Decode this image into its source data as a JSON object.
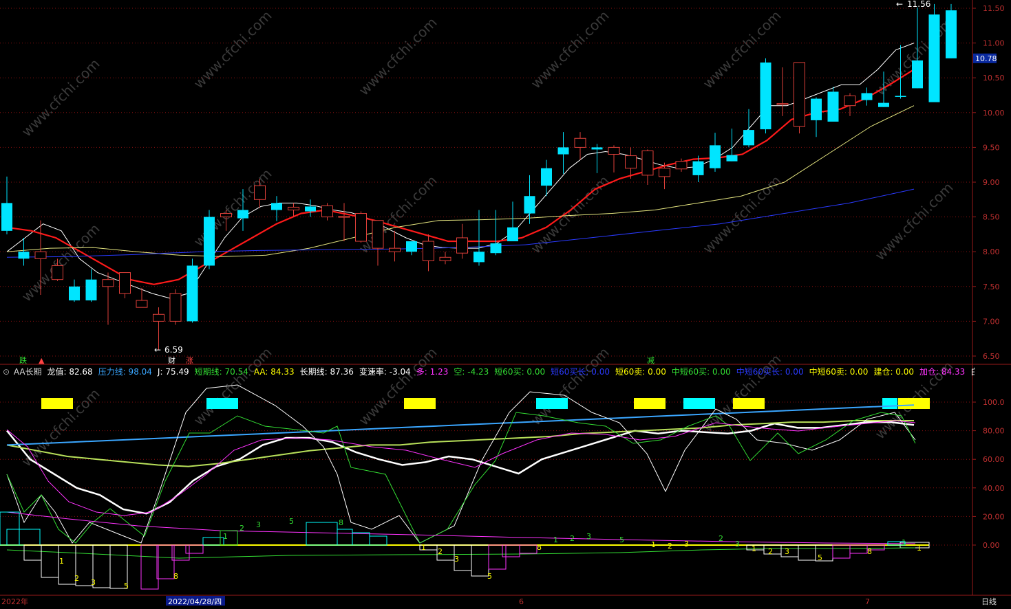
{
  "colors": {
    "up": "#e0403a",
    "down": "#00e5ff",
    "ma_red": "#ff1a1a",
    "ma_white": "#ffffff",
    "ma_yellow": "#e6e680",
    "ma_blue": "#2a3aff",
    "grid_dot": "#8a1010",
    "axis": "#9a1a1a",
    "text_price": "#c03030",
    "ind_white": "#ffffff",
    "ind_magenta": "#ff33ff",
    "ind_green": "#33dd33",
    "ind_skyblue": "#3aa6ff",
    "ind_olive": "#b8e05a",
    "ind_yellow": "#ffff00",
    "ind_cyan": "#00ffff"
  },
  "watermark": "www.cfchi.com",
  "price_axis": {
    "ticks": [
      "11.50",
      "11.00",
      "10.50",
      "10.00",
      "9.50",
      "9.00",
      "8.50",
      "8.00",
      "7.50",
      "7.00",
      "6.50"
    ],
    "current": "10.78"
  },
  "indicator_axis": {
    "ticks": [
      "100.0",
      "80.00",
      "60.00",
      "40.00",
      "20.00",
      "0.00"
    ]
  },
  "annotations": {
    "high": "11.56",
    "low": "6.59",
    "high_arrow": "←",
    "low_arrow": "←"
  },
  "event_markers": [
    {
      "label": "跌",
      "color": "#33dd33"
    },
    {
      "label": "▲",
      "color": "#ff4444"
    },
    {
      "label": "财",
      "color": "#ffffff"
    },
    {
      "label": "涨",
      "color": "#ff4444"
    },
    {
      "label": "减",
      "color": "#33dd33"
    }
  ],
  "indicator_header": {
    "toggle": "⊙",
    "name": "AA长期",
    "items": [
      {
        "label": "龙值: 82.68",
        "color": "#ffffff"
      },
      {
        "label": "压力线: 98.04",
        "color": "#3aa6ff"
      },
      {
        "label": "J: 75.49",
        "color": "#ffffff"
      },
      {
        "label": "短期线: 70.54",
        "color": "#33dd33"
      },
      {
        "label": "AA: 84.33",
        "color": "#ffff00"
      },
      {
        "label": "长期线: 87.36",
        "color": "#ffffff"
      },
      {
        "label": "变速率: -3.04",
        "color": "#ffffff"
      },
      {
        "label": "多: 1.23",
        "color": "#ff33ff"
      },
      {
        "label": "空: -4.23",
        "color": "#33dd33"
      },
      {
        "label": "短60买: 0.00",
        "color": "#33dd33"
      },
      {
        "label": "短60买长: 0.00",
        "color": "#2a3aff"
      },
      {
        "label": "短60卖: 0.00",
        "color": "#ffff00"
      },
      {
        "label": "中短60买: 0.00",
        "color": "#33dd33"
      },
      {
        "label": "中短60买长: 0.00",
        "color": "#2a3aff"
      },
      {
        "label": "中短60卖: 0.00",
        "color": "#ffff00"
      },
      {
        "label": "建仓: 0.00",
        "color": "#ffff00"
      },
      {
        "label": "加仓: 84.33",
        "color": "#ff33ff"
      },
      {
        "label": "白线破",
        "color": "#ffffff"
      }
    ]
  },
  "date_axis": {
    "labels": [
      "2022年",
      "2022/04/28/四",
      "6",
      "7"
    ],
    "period": "日线"
  },
  "chart_data": [
    {
      "type": "candlestick",
      "title": "",
      "x": [
        1,
        2,
        3,
        4,
        5,
        6,
        7,
        8,
        9,
        10,
        11,
        12,
        13,
        14,
        15,
        16,
        17,
        18,
        19,
        20,
        21,
        22,
        23,
        24,
        25,
        26,
        27,
        28,
        29,
        30,
        31,
        32,
        33,
        34,
        35,
        36,
        37,
        38,
        39,
        40,
        41,
        42,
        43,
        44,
        45,
        46,
        47,
        48,
        49,
        50,
        51,
        52,
        53,
        54
      ],
      "open": [
        8.7,
        8.0,
        7.9,
        7.6,
        7.5,
        7.6,
        7.5,
        7.4,
        7.2,
        7.0,
        7.0,
        7.8,
        8.5,
        8.5,
        8.6,
        8.75,
        8.7,
        8.6,
        8.65,
        8.5,
        8.5,
        8.15,
        8.05,
        8.0,
        8.15,
        7.87,
        7.87,
        7.98,
        8.0,
        8.12,
        8.35,
        8.8,
        9.2,
        9.5,
        9.5,
        9.5,
        9.4,
        9.2,
        9.1,
        9.08,
        9.19,
        9.3,
        9.53,
        9.39,
        9.75,
        10.72,
        10.13,
        9.8,
        10.2,
        10.3,
        10.1,
        10.28,
        10.14,
        10.24,
        10.75,
        11.41,
        11.47
      ],
      "close": [
        8.3,
        7.9,
        8.0,
        7.8,
        7.3,
        7.3,
        7.6,
        7.7,
        7.3,
        7.1,
        7.4,
        7.0,
        7.8,
        8.55,
        8.48,
        8.95,
        8.6,
        8.64,
        8.58,
        8.66,
        8.51,
        8.55,
        8.45,
        8.05,
        8.0,
        8.15,
        7.92,
        8.2,
        7.85,
        7.98,
        8.15,
        8.55,
        8.95,
        9.4,
        9.63,
        9.47,
        9.5,
        9.38,
        9.45,
        9.2,
        9.3,
        9.1,
        9.2,
        9.3,
        9.53,
        9.76,
        10.13,
        10.72,
        9.89,
        9.87,
        10.24,
        10.18,
        10.08,
        10.23,
        10.35,
        10.15,
        10.78,
        10.9
      ],
      "high": [
        9.08,
        8.2,
        8.45,
        7.9,
        7.6,
        7.75,
        7.7,
        7.6,
        7.48,
        7.2,
        7.46,
        7.9,
        8.6,
        8.6,
        8.9,
        9.05,
        8.8,
        8.7,
        8.75,
        8.7,
        8.7,
        8.58,
        8.3,
        8.3,
        8.15,
        8.25,
        8.0,
        8.4,
        8.6,
        8.6,
        8.72,
        9.1,
        9.32,
        9.72,
        9.72,
        9.55,
        9.53,
        9.5,
        9.47,
        9.28,
        9.34,
        9.38,
        9.71,
        9.77,
        10.05,
        10.78,
        10.65,
        10.16,
        10.22,
        10.37,
        10.28,
        10.36,
        10.59,
        10.97,
        11.51,
        11.56,
        11.56
      ],
      "low": [
        8.25,
        7.8,
        7.38,
        7.58,
        7.28,
        7.28,
        6.95,
        7.33,
        7.2,
        6.59,
        6.95,
        6.98,
        7.75,
        8.3,
        8.3,
        8.63,
        8.44,
        8.5,
        8.5,
        8.45,
        8.15,
        8.13,
        7.8,
        7.86,
        7.95,
        7.72,
        7.82,
        7.9,
        7.8,
        7.95,
        8.15,
        8.4,
        8.8,
        9.12,
        9.32,
        9.13,
        9.14,
        9.05,
        8.96,
        8.9,
        9.15,
        9.0,
        9.15,
        9.3,
        9.5,
        9.7,
        9.95,
        9.7,
        9.65,
        9.95,
        9.95,
        10.1,
        10.08,
        10.2,
        10.35,
        10.65,
        10.78
      ]
    },
    {
      "type": "line",
      "title": "",
      "series": [
        {
          "values": [
            8.0,
            8.2,
            8.4,
            8.3,
            7.9,
            7.7,
            7.6,
            7.5,
            7.4,
            7.33,
            7.4,
            7.8,
            8.2,
            8.5,
            8.65,
            8.7,
            8.7,
            8.66,
            8.6,
            8.56,
            8.47,
            8.33,
            8.2,
            8.1,
            8.06,
            8.05,
            8.05,
            8.12,
            8.3,
            8.6,
            8.9,
            9.2,
            9.4,
            9.44,
            9.4,
            9.33,
            9.25,
            9.2,
            9.22,
            9.33,
            9.5,
            9.8,
            10.1,
            10.1,
            10.2,
            10.3,
            10.4,
            10.4,
            10.62,
            10.9,
            11.0
          ]
        },
        {
          "values": [
            8.35,
            8.3,
            8.2,
            8.0,
            7.8,
            7.6,
            7.53,
            7.6,
            7.8,
            8.0,
            8.2,
            8.4,
            8.55,
            8.6,
            8.53,
            8.45,
            8.35,
            8.25,
            8.15,
            8.15,
            8.15,
            8.2,
            8.35,
            8.6,
            8.9,
            9.05,
            9.15,
            9.25,
            9.33,
            9.35,
            9.4,
            9.6,
            9.9,
            10.0,
            10.05,
            10.2,
            10.4,
            10.62
          ]
        },
        {
          "values": [
            8.0,
            8.05,
            8.06,
            8.0,
            7.95,
            7.93,
            7.95,
            8.05,
            8.2,
            8.35,
            8.45,
            8.46,
            8.48,
            8.52,
            8.55,
            8.6,
            8.7,
            8.8,
            9.0,
            9.4,
            9.8,
            10.1
          ]
        },
        {
          "values": [
            7.92,
            7.93,
            7.96,
            8.0,
            8.02,
            8.03,
            8.04,
            8.06,
            8.1,
            8.2,
            8.3,
            8.4,
            8.55,
            8.7,
            8.9
          ]
        }
      ]
    },
    {
      "type": "line",
      "title": "",
      "ylim": [
        0,
        100
      ],
      "series": [
        {
          "values": [
            80,
            60,
            50,
            40,
            35,
            25,
            22,
            30,
            45,
            55,
            60,
            70,
            75,
            75,
            72,
            65,
            60,
            56,
            58,
            62,
            60,
            55,
            50,
            60,
            65,
            70,
            75,
            80,
            78,
            80,
            79,
            78,
            80,
            85,
            82,
            82,
            84,
            86,
            86,
            84
          ]
        },
        {
          "values": [
            70,
            66,
            62,
            60,
            58,
            56,
            55,
            57,
            60,
            63,
            66,
            68,
            70,
            70,
            72,
            73,
            74,
            75,
            76,
            78,
            79,
            80,
            81,
            82,
            84,
            85,
            86,
            86,
            87,
            87,
            87
          ]
        },
        {
          "values": [
            70,
            72,
            74,
            76,
            78,
            80,
            82,
            84,
            86,
            88,
            90,
            92,
            94,
            96,
            98
          ]
        }
      ]
    }
  ]
}
